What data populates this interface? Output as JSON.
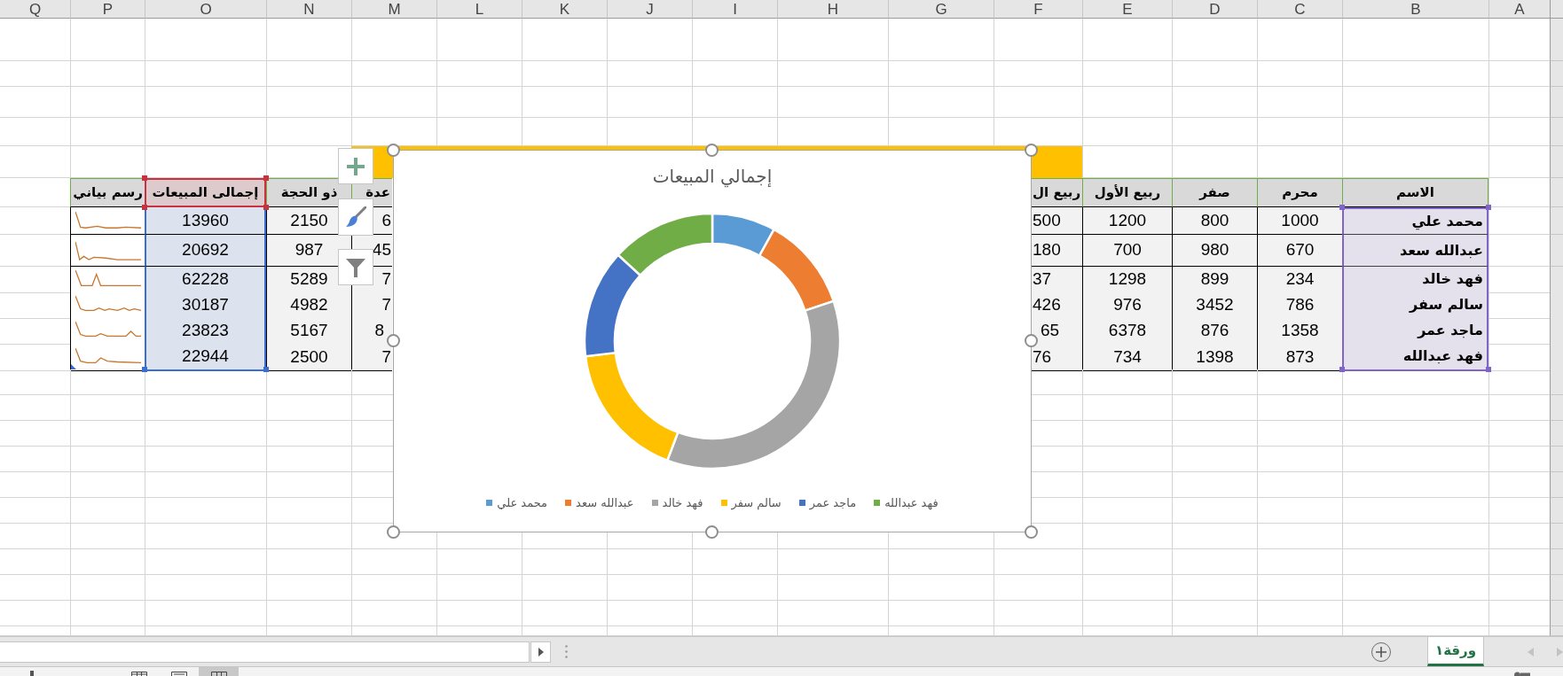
{
  "column_headers": [
    "A",
    "B",
    "C",
    "D",
    "E",
    "F",
    "G",
    "H",
    "I",
    "J",
    "K",
    "L",
    "M",
    "N",
    "O",
    "P",
    "Q"
  ],
  "table": {
    "columns": [
      "الاسم",
      "محرم",
      "صفر",
      "ربيع الأول",
      "ربيع ال",
      "عدة",
      "ذو الحجة",
      "إجمالى المبيعات",
      "رسم بياني"
    ],
    "rows": [
      [
        "محمد علي",
        "1000",
        "800",
        "1200",
        "500",
        "6",
        "2150",
        "13960"
      ],
      [
        "عبدالله سعد",
        "670",
        "980",
        "700",
        "180",
        "45",
        "987",
        "20692"
      ],
      [
        "فهد خالد",
        "234",
        "899",
        "1298",
        "37",
        "7",
        "5289",
        "62228"
      ],
      [
        "سالم سفر",
        "786",
        "3452",
        "976",
        "426",
        "7",
        "4982",
        "30187"
      ],
      [
        "ماجد عمر",
        "1358",
        "876",
        "6378",
        "65",
        "8",
        "5167",
        "23823"
      ],
      [
        "فهد عبدالله",
        "873",
        "1398",
        "734",
        "76",
        "7",
        "2500",
        "22944"
      ]
    ]
  },
  "chart": {
    "title": "إجمالي المبيعات",
    "legend": [
      {
        "label": "فهد عبدالله",
        "color": "#70ad47"
      },
      {
        "label": "ماجد عمر",
        "color": "#4472c4"
      },
      {
        "label": "سالم سفر",
        "color": "#ffc000"
      },
      {
        "label": "فهد خالد",
        "color": "#a5a5a5"
      },
      {
        "label": "عبدالله سعد",
        "color": "#ed7d31"
      },
      {
        "label": "محمد علي",
        "color": "#5b9bd5"
      }
    ]
  },
  "sheet_tabs": [
    {
      "label": "ورقة١",
      "selected": true
    }
  ],
  "status_bar": {
    "view_buttons": [
      {
        "kind": "normal",
        "selected": true
      },
      {
        "kind": "page_layout",
        "selected": false
      },
      {
        "kind": "page_break",
        "selected": false
      }
    ]
  }
}
